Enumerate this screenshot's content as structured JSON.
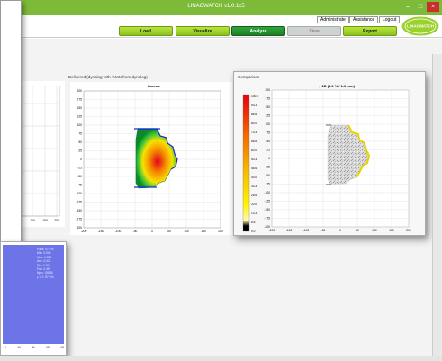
{
  "window": {
    "title": "LINACWATCH v1.0.1c5",
    "minimize": "–",
    "maximize": "□",
    "close": "×"
  },
  "menu": {
    "admin": "Administrate",
    "assistance": "Assistance",
    "logout": "Logout"
  },
  "logo": {
    "text": "LINACWATCH"
  },
  "toolbar": {
    "load": "Load",
    "visualize": "Visualize",
    "analyze": "Analyze",
    "view": "View",
    "export": "Export"
  },
  "delivered": {
    "caption": "Delivered (dynalog with %MU from dynalog)",
    "plot_title": "fluence",
    "x_ticks": [
      "-200",
      "-150",
      "-100",
      "-50",
      "0",
      "50",
      "100",
      "150",
      "200"
    ],
    "y_ticks": [
      "200",
      "175",
      "150",
      "125",
      "100",
      "75",
      "50",
      "25",
      "0",
      "-25",
      "-50",
      "-75",
      "-100",
      "-125",
      "-150",
      "-175",
      "-200"
    ]
  },
  "left_plot": {
    "x_ticks": [
      "100",
      "150",
      "200"
    ]
  },
  "comparison": {
    "caption": "Comparison",
    "plot_title": "γ 2D (1.0 % / 1.0 mm)",
    "colorbar_labels": [
      "100.0",
      "93.3",
      "86.6",
      "80.0",
      "73.3",
      "66.6",
      "60.0",
      "53.3",
      "46.6",
      "40.0",
      "33.3",
      "26.6",
      "20.0",
      "13.3",
      "6.6",
      "0.0"
    ],
    "x_ticks": [
      "-200",
      "-150",
      "-100",
      "-50",
      "0",
      "50",
      "100",
      "150",
      "200"
    ],
    "y_ticks": [
      "200",
      "175",
      "150",
      "125",
      "100",
      "75",
      "50",
      "25",
      "0",
      "-25",
      "-50",
      "-75",
      "-100",
      "-125",
      "-150",
      "-175",
      "-200"
    ]
  },
  "stats": {
    "lines": [
      "Pass: 97.6%",
      "Min: 0.000",
      "Max: 1.352",
      "Ave: 0.231",
      "Std: 0.204",
      "Fail: 2.4%",
      "Npix: 15836",
      "γ < 1: 97.6%"
    ],
    "x_ticks": [
      "0",
      "10",
      "11",
      "12",
      "13"
    ]
  },
  "colors": {
    "title_green": "#7dba3a",
    "button_green": "#a3d22d",
    "active_green": "#278d30",
    "accent_blue": "#1b2bd6"
  }
}
